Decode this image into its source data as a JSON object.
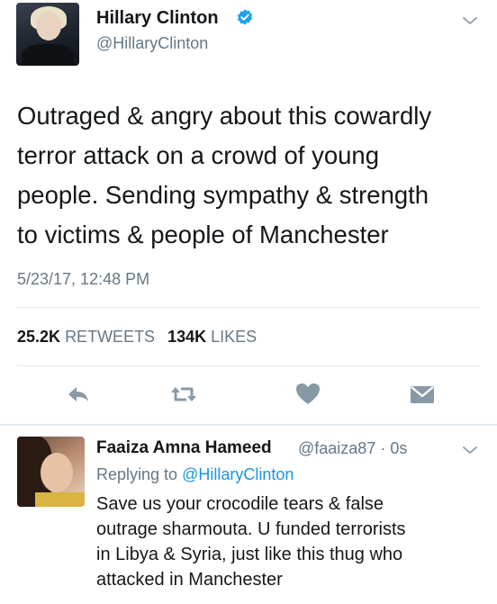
{
  "tweet": {
    "author_name": "Hillary Clinton",
    "author_handle": "@HillaryClinton",
    "verified": true,
    "text": "Outraged & angry about this cowardly\nterror attack on a crowd of young\npeople. Sending sympathy & strength\nto victims & people of Manchester",
    "timestamp": "5/23/17, 12:48 PM",
    "retweets_count": "25.2K",
    "retweets_label": "RETWEETS",
    "likes_count": "134K",
    "likes_label": "LIKES",
    "actions": [
      {
        "icon": "reply-icon"
      },
      {
        "icon": "retweet-icon"
      },
      {
        "icon": "heart-icon"
      },
      {
        "icon": "message-icon"
      }
    ]
  },
  "reply": {
    "author_name": "Faaiza Amna Hameed",
    "author_handle_time": "@faaiza87 · 0s",
    "replying_prefix": "Replying to",
    "replying_mention": "@HillaryClinton",
    "text": "Save us your crocodile tears & false\noutrage sharmouta. U funded terrorists\nin Libya & Syria, just like this thug who\nattacked in Manchester"
  },
  "colors": {
    "text": "#14171a",
    "secondary": "#657786",
    "accent": "#1da1f2",
    "icon": "#8899a6",
    "divider": "#e1e8ed"
  }
}
